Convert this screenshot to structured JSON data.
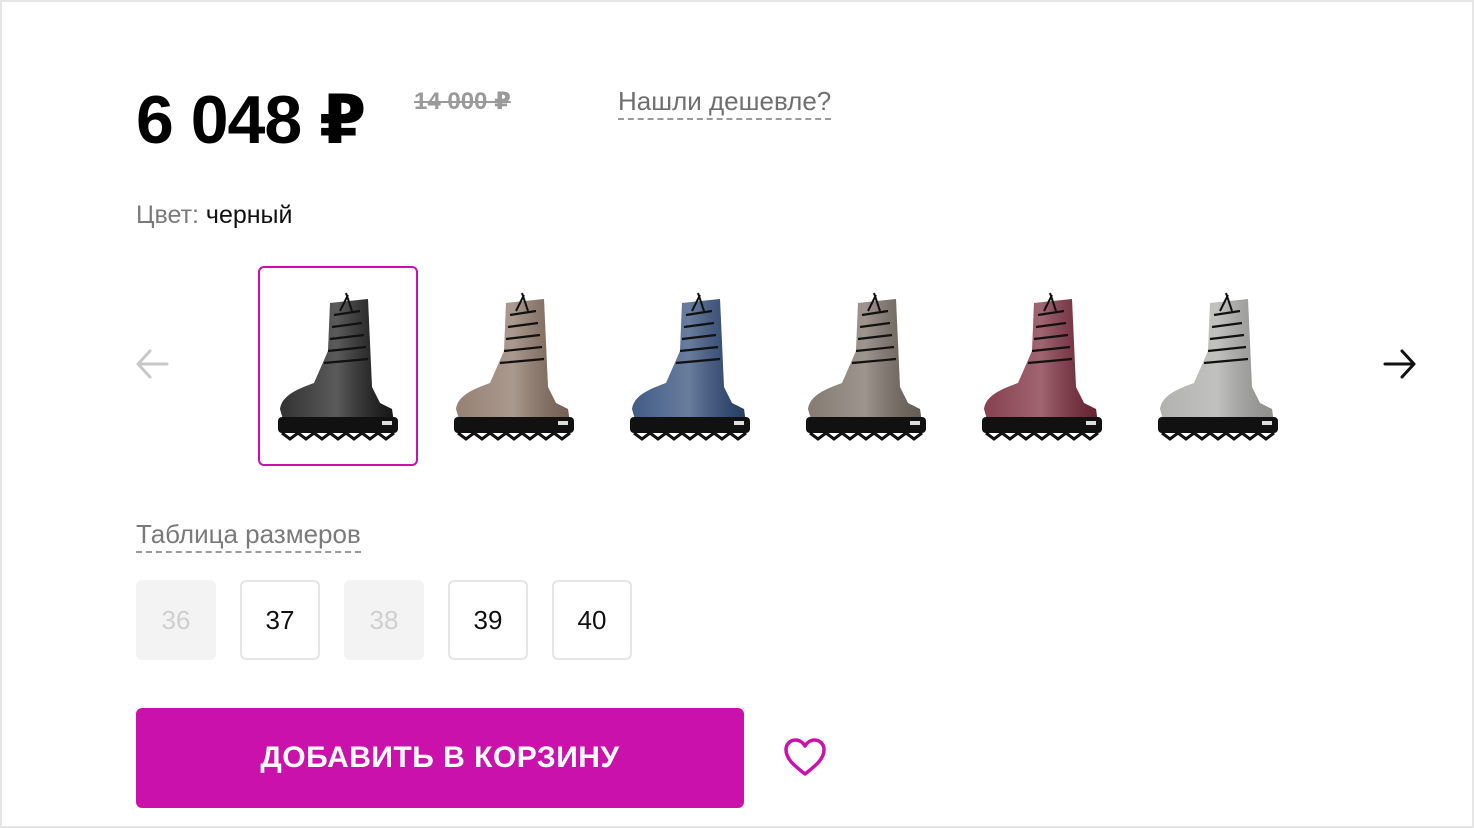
{
  "product": {
    "price": "6 048 ₽",
    "old_price": "14 000 ₽",
    "cheaper_link": "Нашли дешевле?"
  },
  "color": {
    "label": "Цвет:",
    "value": "черный",
    "options": [
      {
        "name": "black",
        "hex": "#1b1b1b",
        "selected": true
      },
      {
        "name": "brown",
        "hex": "#8a7263",
        "selected": false
      },
      {
        "name": "blue",
        "hex": "#2e4a78",
        "selected": false
      },
      {
        "name": "taupe",
        "hex": "#776c62",
        "selected": false
      },
      {
        "name": "burgundy",
        "hex": "#7a2a3a",
        "selected": false
      },
      {
        "name": "silver",
        "hex": "#a9aaa8",
        "selected": false
      }
    ]
  },
  "icons": {
    "prev": "arrow-left-icon",
    "next": "arrow-right-icon",
    "favorite": "heart-icon"
  },
  "size_table": {
    "label": "Таблица размеров"
  },
  "sizes": [
    {
      "label": "36",
      "available": false
    },
    {
      "label": "37",
      "available": true
    },
    {
      "label": "38",
      "available": false
    },
    {
      "label": "39",
      "available": true
    },
    {
      "label": "40",
      "available": true
    }
  ],
  "cart": {
    "add_label": "ДОБАВИТЬ В КОРЗИНУ"
  },
  "colors": {
    "accent": "#cb11ab",
    "price_text": "#000000",
    "muted_text": "#7a7a7a",
    "disabled_bg": "#f3f3f3"
  }
}
